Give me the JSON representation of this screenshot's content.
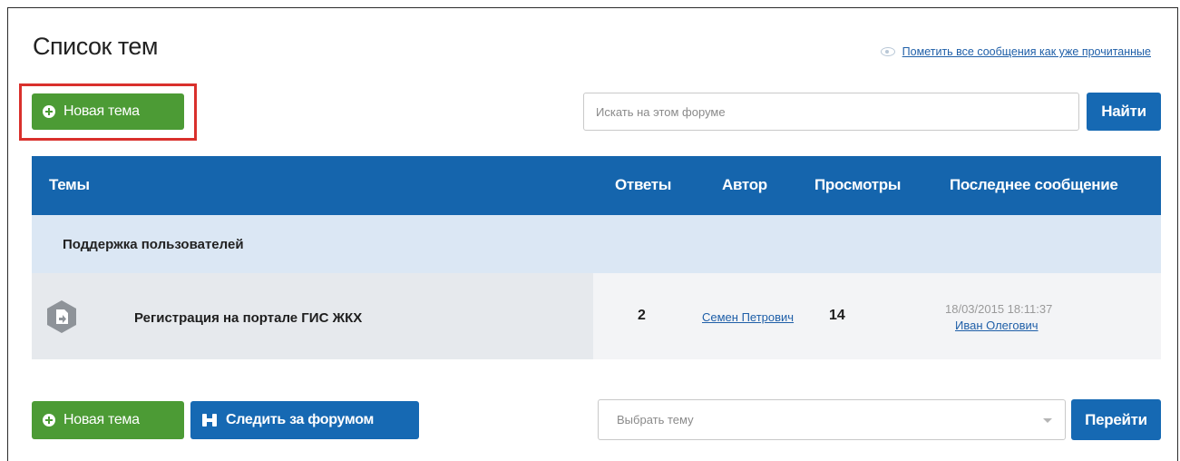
{
  "page": {
    "title": "Список тем",
    "mark_read_label": "Пометить все сообщения как уже прочитанные"
  },
  "toolbar": {
    "new_topic_label": "Новая тема",
    "search_placeholder": "Искать на этом форуме",
    "search_button_label": "Найти"
  },
  "table": {
    "headers": [
      "Темы",
      "Ответы",
      "Автор",
      "Просмотры",
      "Последнее сообщение"
    ],
    "section_label": "Поддержка пользователей",
    "rows": [
      {
        "title": "Регистрация на портале ГИС ЖКХ",
        "replies": "2",
        "author": "Семен Петрович",
        "views": "14",
        "last_date": "18/03/2015 18:11:37",
        "last_author": "Иван Олегович"
      }
    ]
  },
  "footer": {
    "new_topic_label": "Новая тема",
    "watch_label": "Следить за форумом",
    "select_placeholder": "Выбрать тему",
    "go_button_label": "Перейти"
  },
  "colors": {
    "green": "#4c9b35",
    "blue": "#1565ad",
    "highlight": "#d9302c",
    "section_bg": "#dbe7f4"
  }
}
